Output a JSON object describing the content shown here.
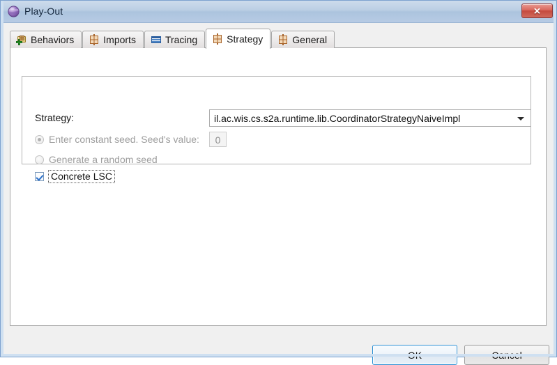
{
  "window": {
    "title": "Play-Out",
    "app_icon": "sphere-icon",
    "close_label": "✕"
  },
  "tabs": [
    {
      "id": "behaviors",
      "label": "Behaviors",
      "icon": "package-icon",
      "selected": false
    },
    {
      "id": "imports",
      "label": "Imports",
      "icon": "grid-icon",
      "selected": false
    },
    {
      "id": "tracing",
      "label": "Tracing",
      "icon": "table-icon",
      "selected": false
    },
    {
      "id": "strategy",
      "label": "Strategy",
      "icon": "grid-icon",
      "selected": true
    },
    {
      "id": "general",
      "label": "General",
      "icon": "grid-icon",
      "selected": false
    }
  ],
  "strategy_panel": {
    "strategy_label": "Strategy:",
    "strategy_value": "il.ac.wis.cs.s2a.runtime.lib.CoordinatorStrategyNaiveImpl",
    "constant_seed_label": "Enter constant seed. Seed's value:",
    "seed_value": "0",
    "random_seed_label": "Generate a random seed",
    "concrete_lsc_label": "Concrete LSC"
  },
  "buttons": {
    "ok": "OK",
    "cancel": "Cancel"
  },
  "colors": {
    "titlebar": "#b7cbe4",
    "close_button": "#c44a3e",
    "accent_focus": "#2a8fd4",
    "checkmark": "#2a6fc9",
    "disabled_text": "#9d9d9d"
  }
}
